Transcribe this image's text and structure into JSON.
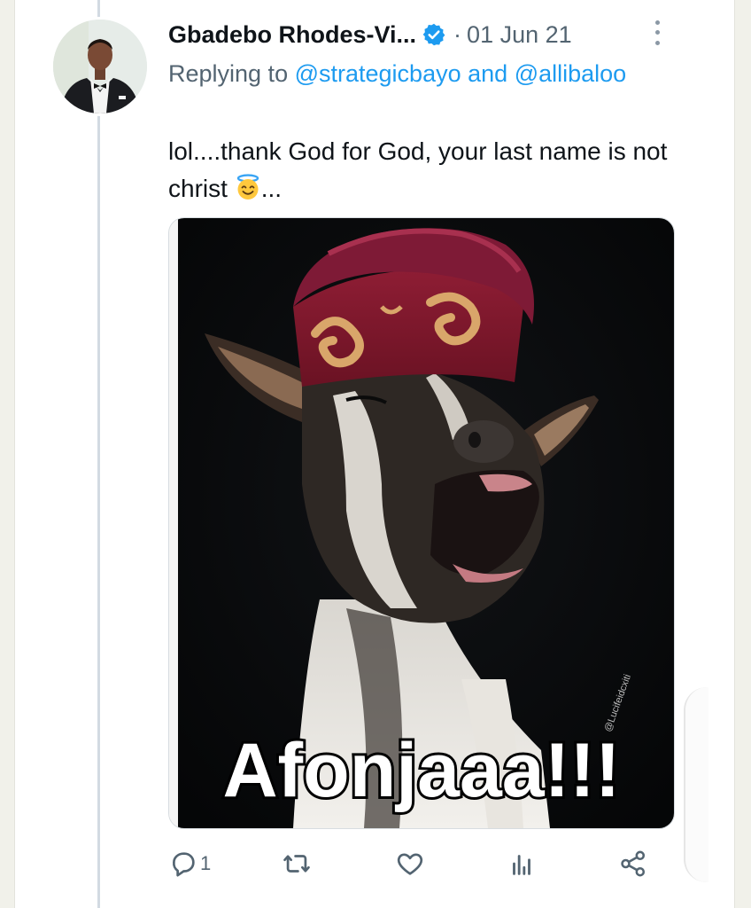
{
  "tweet": {
    "author_name": "Gbadebo Rhodes-Vi...",
    "separator": "·",
    "date": "01 Jun 21",
    "replying_prefix": "Replying to",
    "mention_1": "@strategicbayo",
    "replying_and": "and",
    "mention_2": "@allibaloo",
    "text_part_1": "lol....thank God for God, your last name is not christ",
    "text_part_2": "...",
    "emoji": "smiling-face-with-halo",
    "media": {
      "caption": "Afonjaaa!!!",
      "watermark": "@Lucifeidcxiti"
    },
    "actions": {
      "reply_count": "1"
    }
  },
  "colors": {
    "accent": "#1d9bf0",
    "muted": "#536471",
    "text": "#0f1419"
  },
  "icons": [
    "verified-badge-icon",
    "more-options-icon",
    "reply-icon",
    "retweet-icon",
    "like-icon",
    "analytics-icon",
    "share-icon"
  ]
}
